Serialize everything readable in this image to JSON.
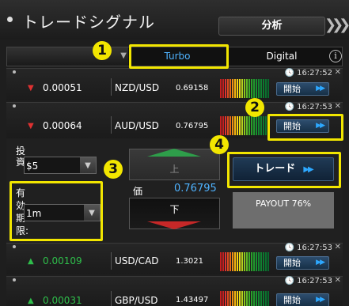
{
  "header": {
    "title": "トレードシグナル",
    "analysis_label": "分析"
  },
  "tabs": {
    "turbo": "Turbo",
    "digital": "Digital",
    "info": "i"
  },
  "rows": [
    {
      "time": "16:27:52",
      "direction": "down",
      "change": "0.00051",
      "pair": "NZD/USD",
      "price": "0.69158",
      "start": "開始"
    },
    {
      "time": "16:27:53",
      "direction": "down",
      "change": "0.00064",
      "pair": "AUD/USD",
      "price": "0.76795",
      "start": "開始"
    },
    {
      "time": "16:27:53",
      "direction": "up",
      "change": "0.00109",
      "pair": "USD/CAD",
      "price": "1.3021",
      "start": "開始"
    },
    {
      "time": "16:27:53",
      "direction": "up",
      "change": "0.00031",
      "pair": "GBP/USD",
      "price": "1.43497",
      "start": "開始"
    }
  ],
  "panel": {
    "investment_label": "投資",
    "investment_value": "$5",
    "expiry_label": "有効期限:",
    "expiry_value": "1m",
    "up_label": "上",
    "down_label": "下",
    "price_label": "価",
    "price_value": "0.76795",
    "trade_label": "トレード",
    "payout": "PAYOUT 76%"
  },
  "callouts": [
    "1",
    "2",
    "3",
    "4"
  ],
  "colors": {
    "accent_blue": "#4fb3ff",
    "callout_yellow": "#f2e600",
    "down_red": "#e03131",
    "up_green": "#2fbf4b"
  }
}
